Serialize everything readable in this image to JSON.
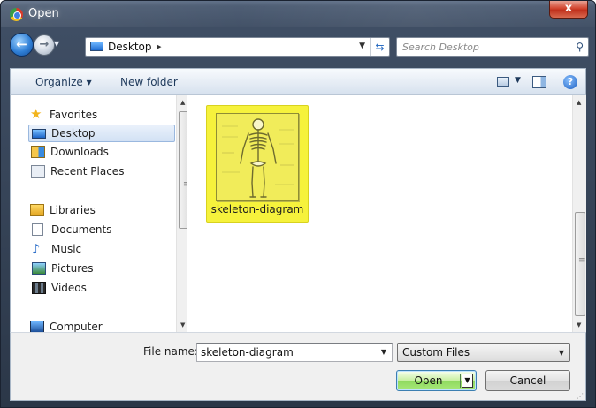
{
  "window": {
    "title": "Open",
    "close_label": "x"
  },
  "nav": {
    "back_icon": "back-arrow-icon",
    "forward_icon": "forward-arrow-icon",
    "address": {
      "location": "Desktop",
      "separator": "▸"
    },
    "search_placeholder": "Search Desktop"
  },
  "toolbar": {
    "organize_label": "Organize ▾",
    "new_folder_label": "New folder"
  },
  "sidebar": {
    "items": [
      {
        "label": "Favorites",
        "icon": "star-icon",
        "selected": false
      },
      {
        "label": "Desktop",
        "icon": "desktop-icon",
        "selected": true
      },
      {
        "label": "Downloads",
        "icon": "downloads-icon",
        "selected": false
      },
      {
        "label": "Recent Places",
        "icon": "recent-places-icon",
        "selected": false
      },
      {
        "label": "Libraries",
        "icon": "libraries-icon",
        "selected": false
      },
      {
        "label": "Documents",
        "icon": "documents-icon",
        "selected": false
      },
      {
        "label": "Music",
        "icon": "music-icon",
        "selected": false
      },
      {
        "label": "Pictures",
        "icon": "pictures-icon",
        "selected": false
      },
      {
        "label": "Videos",
        "icon": "videos-icon",
        "selected": false
      },
      {
        "label": "Computer",
        "icon": "computer-icon",
        "selected": false
      }
    ]
  },
  "files": [
    {
      "name": "skeleton-diagram",
      "selected": true,
      "thumbnail": "skeleton-thumbnail"
    }
  ],
  "footer": {
    "file_name_label": "File name:",
    "file_name_value": "skeleton-diagram",
    "filter_value": "Custom Files",
    "open_label": "Open",
    "cancel_label": "Cancel"
  },
  "colors": {
    "selection_yellow": "#f6f23c",
    "open_button_green": "#8fda5f",
    "title_bar": "#3f4e64",
    "close_red": "#c0301c"
  }
}
